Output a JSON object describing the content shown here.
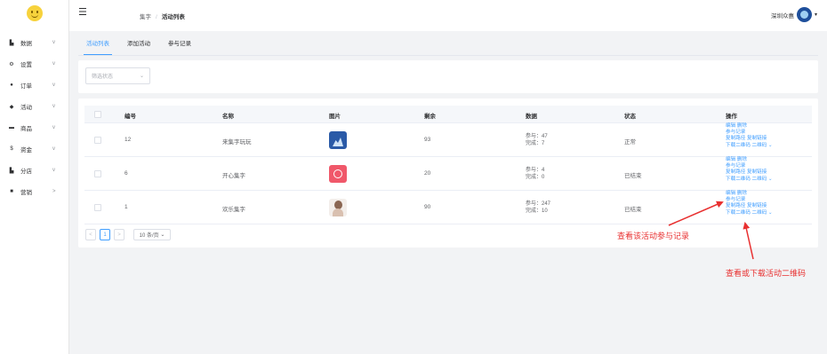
{
  "sidebar": {
    "items": [
      {
        "label": "数据",
        "icon": "bar-chart-icon",
        "chevron": "v"
      },
      {
        "label": "设置",
        "icon": "settings-icon",
        "chevron": "v"
      },
      {
        "label": "订单",
        "icon": "order-icon",
        "chevron": "v"
      },
      {
        "label": "活动",
        "icon": "activity-icon",
        "chevron": "v"
      },
      {
        "label": "商品",
        "icon": "goods-icon",
        "chevron": "v"
      },
      {
        "label": "资金",
        "icon": "money-icon",
        "chevron": "v"
      },
      {
        "label": "分店",
        "icon": "branch-icon",
        "chevron": "v"
      },
      {
        "label": "营销",
        "icon": "marketing-icon",
        "chevron": ">"
      }
    ]
  },
  "header": {
    "breadcrumb": {
      "parent": "集字",
      "separator": "/",
      "current": "活动列表"
    },
    "user_name": "深圳众惠"
  },
  "tabs": [
    "活动列表",
    "添加活动",
    "参与记录"
  ],
  "filter": {
    "placeholder": "筛选状态"
  },
  "table": {
    "columns": [
      "编号",
      "名称",
      "图片",
      "剩余",
      "数据",
      "状态",
      "操作"
    ],
    "rows": [
      {
        "id": "12",
        "name": "来集字玩玩",
        "remaining": "93",
        "data1": "参与：47",
        "data2": "完成：7",
        "status": "正常"
      },
      {
        "id": "6",
        "name": "开心集字",
        "remaining": "20",
        "data1": "参与：4",
        "data2": "完成：0",
        "status": "已结束"
      },
      {
        "id": "1",
        "name": "欢乐集字",
        "remaining": "90",
        "data1": "参与：247",
        "data2": "完成：10",
        "status": "已结束"
      }
    ],
    "operations": {
      "edit": "编辑",
      "delete": "删除",
      "records": "参与记录",
      "copy_path": "复制路径",
      "copy_link": "复制链接",
      "download_qr": "下载二维码",
      "qr": "二维码"
    }
  },
  "pagination": {
    "prev": "<",
    "page": "1",
    "next": ">",
    "page_size": "10 条/页"
  },
  "annotations": {
    "records_hint": "查看该活动参与记录",
    "qr_hint": "查看或下载活动二维码"
  },
  "colors": {
    "accent": "#409eff",
    "annotation": "#e83030"
  }
}
